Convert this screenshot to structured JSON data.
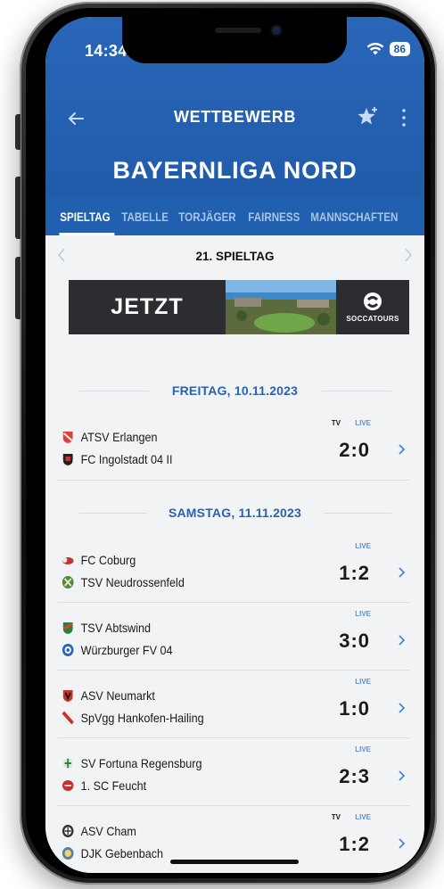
{
  "status_bar": {
    "time": "14:34",
    "battery": "86"
  },
  "topbar": {
    "title": "WETTBEWERB"
  },
  "league": {
    "title": "BAYERNLIGA NORD"
  },
  "tabs": [
    {
      "label": "SPIELTAG",
      "active": true
    },
    {
      "label": "TABELLE",
      "active": false
    },
    {
      "label": "TORJÄGER",
      "active": false
    },
    {
      "label": "FAIRNESS",
      "active": false
    },
    {
      "label": "MANNSCHAFTEN",
      "active": false
    }
  ],
  "matchday": {
    "label": "21. SPIELTAG"
  },
  "banner": {
    "text": "JETZT",
    "logo_text": "SOCCATOURS"
  },
  "date_groups": [
    {
      "label": "FREITAG, 10.11.2023"
    },
    {
      "label": "SAMSTAG, 11.11.2023"
    }
  ],
  "matches": [
    {
      "home": "ATSV Erlangen",
      "away": "FC Ingolstadt 04 II",
      "score": "2:0",
      "tv": "TV",
      "live": "LIVE"
    },
    {
      "home": "FC Coburg",
      "away": "TSV Neudrossenfeld",
      "score": "1:2",
      "tv": "",
      "live": "LIVE"
    },
    {
      "home": "TSV Abtswind",
      "away": "Würzburger FV 04",
      "score": "3:0",
      "tv": "",
      "live": "LIVE"
    },
    {
      "home": "ASV Neumarkt",
      "away": "SpVgg Hankofen-Hailing",
      "score": "1:0",
      "tv": "",
      "live": "LIVE"
    },
    {
      "home": "SV Fortuna Regensburg",
      "away": "1. SC Feucht",
      "score": "2:3",
      "tv": "",
      "live": "LIVE"
    },
    {
      "home": "ASV Cham",
      "away": "DJK Gebenbach",
      "score": "1:2",
      "tv": "TV",
      "live": "LIVE"
    }
  ],
  "colors": {
    "header": "#2160ae",
    "accent": "#2a62b0",
    "live": "#5b92d8"
  }
}
